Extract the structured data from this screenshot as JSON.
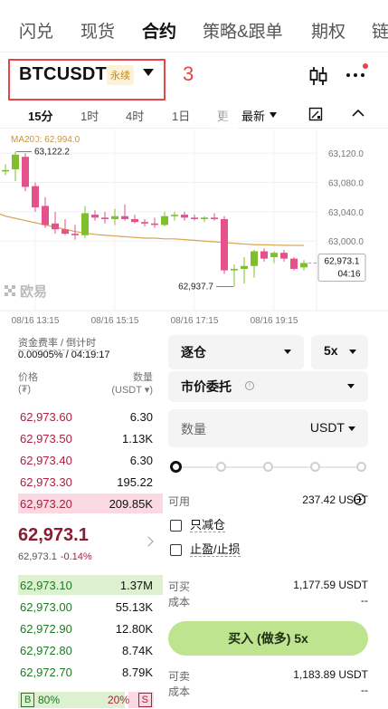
{
  "nav": {
    "tabs": [
      {
        "label": "闪兑",
        "active": false
      },
      {
        "label": "现货",
        "active": false
      },
      {
        "label": "合约",
        "active": true
      },
      {
        "label": "策略&跟单",
        "active": false
      },
      {
        "label": "期权",
        "active": false
      },
      {
        "label": "链",
        "active": false
      }
    ]
  },
  "pair": {
    "symbol": "BTCUSDT",
    "badge": "永续",
    "annotation": "3"
  },
  "timeframes": [
    "15分",
    "1时",
    "4时",
    "1日",
    "更"
  ],
  "timeframe_active": 0,
  "latest_label": "最新",
  "icons": {
    "candle": "candlestick-icon",
    "more": "more-icon",
    "draw": "drawing-tool-icon",
    "collapse": "chevron-up-icon",
    "plus": "plus-circle-icon",
    "info": "info-icon"
  },
  "chart_data": {
    "type": "candlestick",
    "indicator_label": "MA200: 62,994.0",
    "watermark": "欧易",
    "ylim": [
      62910,
      63140
    ],
    "y_ticks": [
      "63,120.0",
      "63,080.0",
      "63,040.0",
      "63,000.0"
    ],
    "y_tick_values": [
      63120,
      63080,
      63040,
      63000
    ],
    "x_ticks": [
      "08/16 13:15",
      "08/16 15:15",
      "08/16 17:15",
      "08/16 19:15"
    ],
    "x_tick_index": [
      3,
      11,
      19,
      27
    ],
    "high_label": "63,122.2",
    "low_label": "62,937.7",
    "last_price_label": "62,973.1",
    "countdown": "04:16",
    "candles": [
      {
        "o": 63095,
        "h": 63105,
        "l": 63090,
        "c": 63097
      },
      {
        "o": 63098,
        "h": 63122.2,
        "l": 63082,
        "c": 63118
      },
      {
        "o": 63115,
        "h": 63120,
        "l": 63068,
        "c": 63074
      },
      {
        "o": 63075,
        "h": 63080,
        "l": 63040,
        "c": 63046
      },
      {
        "o": 63048,
        "h": 63060,
        "l": 63018,
        "c": 63022
      },
      {
        "o": 63024,
        "h": 63040,
        "l": 63010,
        "c": 63016
      },
      {
        "o": 63016,
        "h": 63030,
        "l": 63008,
        "c": 63010
      },
      {
        "o": 63010,
        "h": 63022,
        "l": 63002,
        "c": 63008
      },
      {
        "o": 63008,
        "h": 63048,
        "l": 63004,
        "c": 63038
      },
      {
        "o": 63036,
        "h": 63042,
        "l": 63028,
        "c": 63032
      },
      {
        "o": 63032,
        "h": 63040,
        "l": 63024,
        "c": 63030
      },
      {
        "o": 63030,
        "h": 63044,
        "l": 63022,
        "c": 63034
      },
      {
        "o": 63034,
        "h": 63050,
        "l": 63028,
        "c": 63030
      },
      {
        "o": 63030,
        "h": 63036,
        "l": 63024,
        "c": 63026
      },
      {
        "o": 63026,
        "h": 63030,
        "l": 63020,
        "c": 63024
      },
      {
        "o": 63024,
        "h": 63032,
        "l": 63018,
        "c": 63022
      },
      {
        "o": 63022,
        "h": 63040,
        "l": 63020,
        "c": 63034
      },
      {
        "o": 63034,
        "h": 63040,
        "l": 63028,
        "c": 63036
      },
      {
        "o": 63036,
        "h": 63040,
        "l": 63028,
        "c": 63032
      },
      {
        "o": 63032,
        "h": 63036,
        "l": 63028,
        "c": 63030
      },
      {
        "o": 63030,
        "h": 63034,
        "l": 63026,
        "c": 63032
      },
      {
        "o": 63032,
        "h": 63038,
        "l": 63028,
        "c": 63030
      },
      {
        "o": 63030,
        "h": 63034,
        "l": 62955,
        "c": 62960
      },
      {
        "o": 62960,
        "h": 62968,
        "l": 62937.7,
        "c": 62962
      },
      {
        "o": 62962,
        "h": 62978,
        "l": 62942,
        "c": 62966
      },
      {
        "o": 62966,
        "h": 62988,
        "l": 62950,
        "c": 62986
      },
      {
        "o": 62986,
        "h": 62990,
        "l": 62972,
        "c": 62976
      },
      {
        "o": 62978,
        "h": 62986,
        "l": 62970,
        "c": 62984
      },
      {
        "o": 62984,
        "h": 62988,
        "l": 62972,
        "c": 62976
      },
      {
        "o": 62976,
        "h": 62978,
        "l": 62960,
        "c": 62962
      },
      {
        "o": 62964,
        "h": 62974,
        "l": 62960,
        "c": 62970
      }
    ],
    "ma200": [
      63034,
      63031,
      63028,
      63025,
      63022,
      63019,
      63016,
      63013,
      63011,
      63009,
      63008,
      63007,
      63006,
      63005,
      63004,
      63004,
      63003,
      63003,
      63002,
      63001,
      63000,
      62999,
      62998,
      62997,
      62996,
      62995,
      62995,
      62994.5,
      62994.2,
      62994.0,
      62994.0
    ]
  },
  "orderbook": {
    "funding_label": "资金费率 / 倒计时",
    "funding_value": "0.00905% / 04:19:17",
    "price_header": "价格",
    "price_unit": "(₮)",
    "qty_header": "数量",
    "qty_unit": "(USDT ▾)",
    "asks": [
      {
        "price": "62,973.60",
        "qty": "6.30",
        "depth": 0.0
      },
      {
        "price": "62,973.50",
        "qty": "1.13K",
        "depth": 0.0
      },
      {
        "price": "62,973.40",
        "qty": "6.30",
        "depth": 0.0
      },
      {
        "price": "62,973.30",
        "qty": "195.22",
        "depth": 0.0
      },
      {
        "price": "62,973.20",
        "qty": "209.85K",
        "depth": 1.0
      }
    ],
    "mid_price": "62,973.1",
    "mid_sub": "62,973.1",
    "mid_change": "-0.14%",
    "bids": [
      {
        "price": "62,973.10",
        "qty": "1.37M",
        "depth": 1.0
      },
      {
        "price": "62,973.00",
        "qty": "55.13K",
        "depth": 0.0
      },
      {
        "price": "62,972.90",
        "qty": "12.80K",
        "depth": 0.0
      },
      {
        "price": "62,972.80",
        "qty": "8.74K",
        "depth": 0.0
      },
      {
        "price": "62,972.70",
        "qty": "8.79K",
        "depth": 0.0
      }
    ],
    "buy_ratio_label": "B",
    "buy_ratio": "80%",
    "sell_ratio": "20%",
    "sell_ratio_label": "S",
    "buy_ratio_fraction": 0.8
  },
  "form": {
    "margin_mode": "逐仓",
    "leverage": "5x",
    "order_type": "市价委托",
    "qty_placeholder": "数量",
    "qty_unit": "USDT",
    "slider_level": 0,
    "available_label": "可用",
    "available_value": "237.42 USDT",
    "reduce_only": "只减仓",
    "tp_sl": "止盈/止损",
    "can_buy_label": "可买",
    "can_buy_value": "1,177.59 USDT",
    "cost_label": "成本",
    "cost_value": "--",
    "buy_button": "买入 (做多) 5x",
    "can_sell_label": "可卖",
    "can_sell_value": "1,183.89 USDT",
    "cost2_label": "成本",
    "cost2_value": "--"
  }
}
